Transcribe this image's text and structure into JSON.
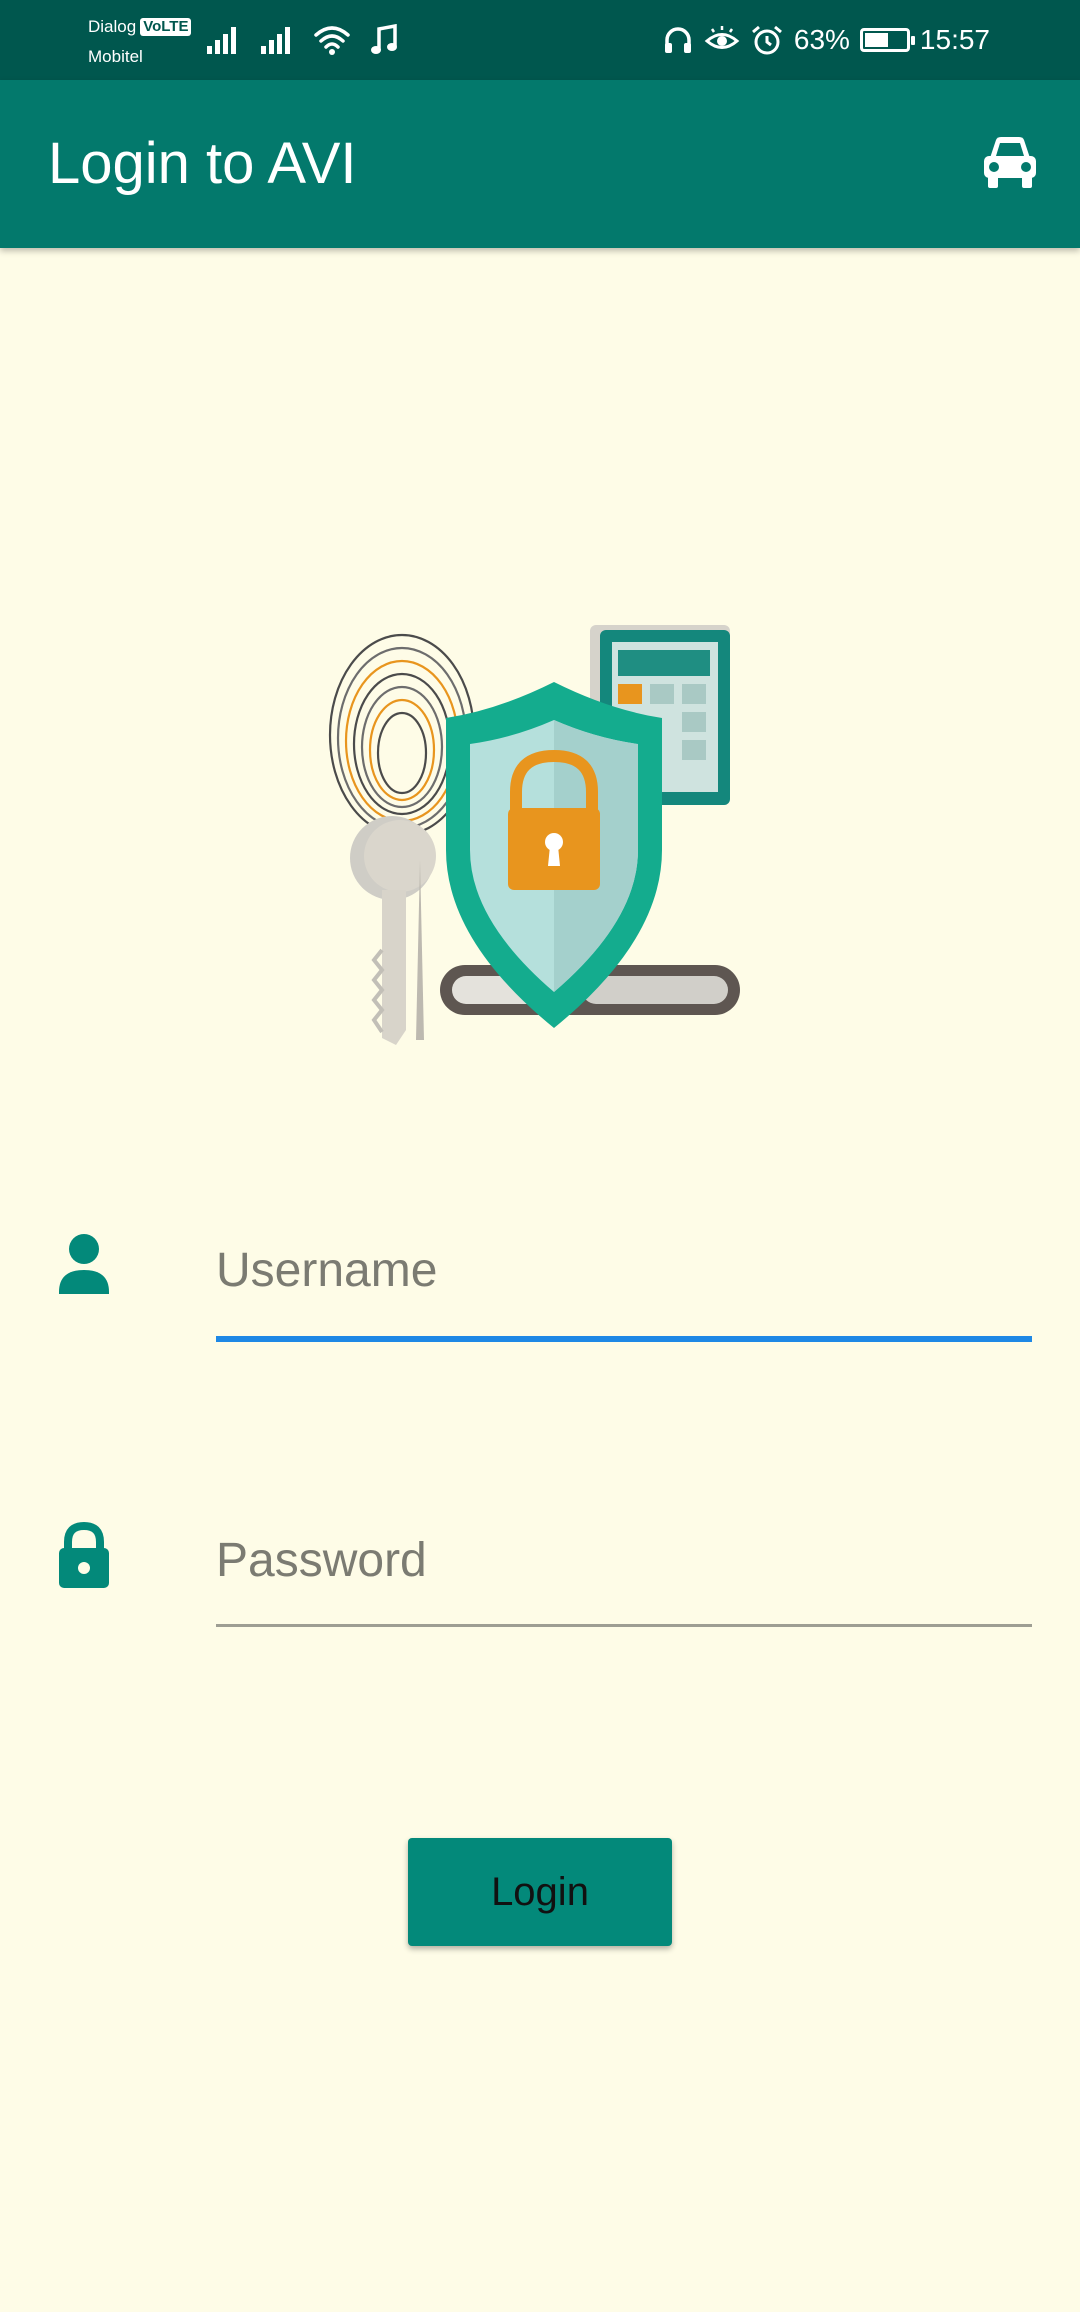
{
  "status_bar": {
    "carrier_1": "Dialog",
    "volte_badge": "VoLTE",
    "carrier_2": "Mobitel",
    "battery_percent": "63%",
    "battery_level": 0.63,
    "time": "15:57",
    "icons": [
      "signal-icon",
      "signal-icon",
      "wifi-icon",
      "music-note-icon",
      "headphones-icon",
      "eye-comfort-icon",
      "alarm-icon",
      "battery-charging-icon"
    ]
  },
  "app_bar": {
    "title": "Login to AVI",
    "action_icon": "car-icon"
  },
  "form": {
    "username": {
      "placeholder": "Username",
      "value": "",
      "icon": "person-icon",
      "focused": true
    },
    "password": {
      "placeholder": "Password",
      "value": "",
      "icon": "lock-icon",
      "focused": false
    },
    "login_label": "Login"
  },
  "colors": {
    "status_bar": "#00574E",
    "app_bar": "#03796C",
    "background": "#FEFCE7",
    "accent": "#03897A",
    "focus_underline": "#1E88E5",
    "underline": "#9E9E93",
    "icon": "#03897A"
  }
}
